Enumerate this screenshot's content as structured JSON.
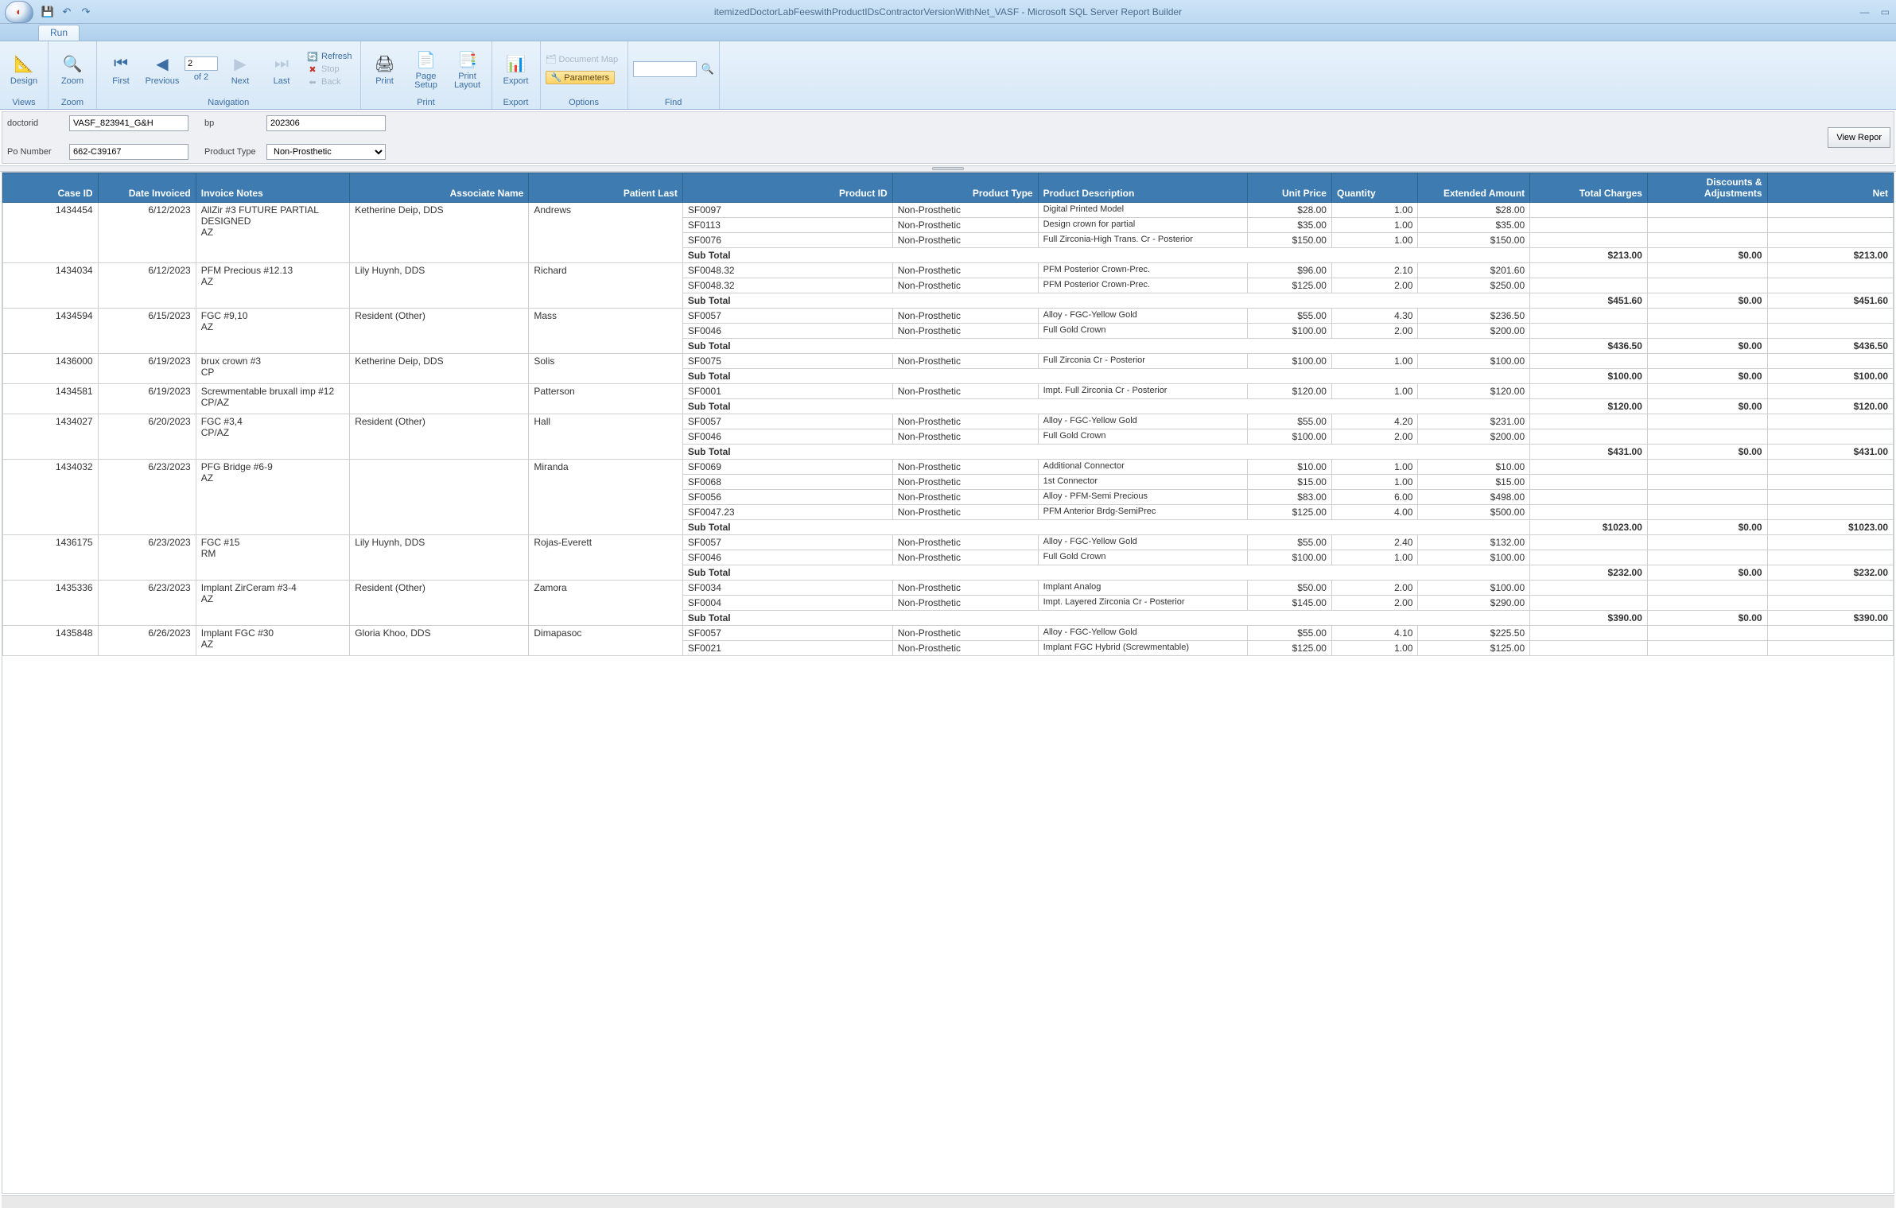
{
  "window": {
    "title": "itemizedDoctorLabFeeswithProductIDsContractorVersionWithNet_VASF - Microsoft SQL Server Report Builder"
  },
  "tabs": {
    "run": "Run"
  },
  "ribbon": {
    "views": {
      "label": "Views",
      "design": "Design"
    },
    "zoom": {
      "label": "Zoom",
      "zoom": "Zoom"
    },
    "navigation": {
      "label": "Navigation",
      "first": "First",
      "previous": "Previous",
      "next": "Next",
      "last": "Last",
      "page": "2",
      "of": "of  2",
      "refresh": "Refresh",
      "stop": "Stop",
      "back": "Back"
    },
    "print": {
      "label": "Print",
      "print": "Print",
      "page_setup": "Page\nSetup",
      "print_layout": "Print\nLayout"
    },
    "export": {
      "label": "Export",
      "export": "Export"
    },
    "options": {
      "label": "Options",
      "document_map": "Document Map",
      "parameters": "Parameters"
    },
    "find": {
      "label": "Find"
    }
  },
  "params": {
    "doctorid_label": "doctorid",
    "doctorid": "VASF_823941_G&H",
    "bp_label": "bp",
    "bp": "202306",
    "po_label": "Po Number",
    "po": "662-C39167",
    "ptype_label": "Product Type",
    "ptype": "Non-Prosthetic",
    "view_report": "View Repor"
  },
  "headers": {
    "case": "Case ID",
    "date": "Date Invoiced",
    "notes": "Invoice Notes",
    "assoc": "Associate Name",
    "patient": "Patient Last",
    "prodid": "Product ID",
    "ptype": "Product Type",
    "pdesc": "Product Description",
    "uprice": "Unit Price",
    "qty": "Quantity",
    "ext": "Extended Amount",
    "total": "Total Charges",
    "disc": "Discounts & Adjustments",
    "net": "Net"
  },
  "subtotal_label": "Sub Total",
  "cases": [
    {
      "case": "1434454",
      "date": "6/12/2023",
      "notes": "AllZir #3    FUTURE PARTIAL DESIGNED\nAZ",
      "assoc": "Ketherine Deip, DDS",
      "patient": "Andrews",
      "lines": [
        {
          "prodid": "SF0097",
          "ptype": "Non-Prosthetic",
          "pdesc": "Digital Printed Model",
          "uprice": "$28.00",
          "qty": "1.00",
          "ext": "$28.00"
        },
        {
          "prodid": "SF0113",
          "ptype": "Non-Prosthetic",
          "pdesc": "Design crown for partial",
          "uprice": "$35.00",
          "qty": "1.00",
          "ext": "$35.00"
        },
        {
          "prodid": "SF0076",
          "ptype": "Non-Prosthetic",
          "pdesc": "Full Zirconia-High Trans. Cr - Posterior",
          "uprice": "$150.00",
          "qty": "1.00",
          "ext": "$150.00"
        }
      ],
      "sub": {
        "total": "$213.00",
        "disc": "$0.00",
        "net": "$213.00"
      }
    },
    {
      "case": "1434034",
      "date": "6/12/2023",
      "notes": "PFM Precious #12.13\nAZ",
      "assoc": "Lily Huynh, DDS",
      "patient": "Richard",
      "lines": [
        {
          "prodid": "SF0048.32",
          "ptype": "Non-Prosthetic",
          "pdesc": "PFM Posterior Crown-Prec.",
          "uprice": "$96.00",
          "qty": "2.10",
          "ext": "$201.60"
        },
        {
          "prodid": "SF0048.32",
          "ptype": "Non-Prosthetic",
          "pdesc": "PFM Posterior Crown-Prec.",
          "uprice": "$125.00",
          "qty": "2.00",
          "ext": "$250.00"
        }
      ],
      "sub": {
        "total": "$451.60",
        "disc": "$0.00",
        "net": "$451.60"
      }
    },
    {
      "case": "1434594",
      "date": "6/15/2023",
      "notes": "FGC #9,10\nAZ",
      "assoc": "Resident  (Other)",
      "patient": "Mass",
      "lines": [
        {
          "prodid": "SF0057",
          "ptype": "Non-Prosthetic",
          "pdesc": "Alloy - FGC-Yellow Gold",
          "uprice": "$55.00",
          "qty": "4.30",
          "ext": "$236.50"
        },
        {
          "prodid": "SF0046",
          "ptype": "Non-Prosthetic",
          "pdesc": "Full Gold Crown",
          "uprice": "$100.00",
          "qty": "2.00",
          "ext": "$200.00"
        }
      ],
      "sub": {
        "total": "$436.50",
        "disc": "$0.00",
        "net": "$436.50"
      }
    },
    {
      "case": "1436000",
      "date": "6/19/2023",
      "notes": "brux crown #3\nCP",
      "assoc": "Ketherine Deip, DDS",
      "patient": "Solis",
      "lines": [
        {
          "prodid": "SF0075",
          "ptype": "Non-Prosthetic",
          "pdesc": "Full Zirconia Cr - Posterior",
          "uprice": "$100.00",
          "qty": "1.00",
          "ext": "$100.00"
        }
      ],
      "sub": {
        "total": "$100.00",
        "disc": "$0.00",
        "net": "$100.00"
      }
    },
    {
      "case": "1434581",
      "date": "6/19/2023",
      "notes": "Screwmentable bruxall imp #12\nCP/AZ",
      "assoc": "",
      "patient": "Patterson",
      "lines": [
        {
          "prodid": "SF0001",
          "ptype": "Non-Prosthetic",
          "pdesc": "Impt. Full Zirconia Cr - Posterior",
          "uprice": "$120.00",
          "qty": "1.00",
          "ext": "$120.00"
        }
      ],
      "sub": {
        "total": "$120.00",
        "disc": "$0.00",
        "net": "$120.00"
      }
    },
    {
      "case": "1434027",
      "date": "6/20/2023",
      "notes": "FGC #3,4\nCP/AZ",
      "assoc": "Resident  (Other)",
      "patient": "Hall",
      "lines": [
        {
          "prodid": "SF0057",
          "ptype": "Non-Prosthetic",
          "pdesc": "Alloy - FGC-Yellow Gold",
          "uprice": "$55.00",
          "qty": "4.20",
          "ext": "$231.00"
        },
        {
          "prodid": "SF0046",
          "ptype": "Non-Prosthetic",
          "pdesc": "Full Gold Crown",
          "uprice": "$100.00",
          "qty": "2.00",
          "ext": "$200.00"
        }
      ],
      "sub": {
        "total": "$431.00",
        "disc": "$0.00",
        "net": "$431.00"
      }
    },
    {
      "case": "1434032",
      "date": "6/23/2023",
      "notes": "PFG Bridge #6-9\nAZ",
      "assoc": "",
      "patient": "Miranda",
      "lines": [
        {
          "prodid": "SF0069",
          "ptype": "Non-Prosthetic",
          "pdesc": "Additional Connector",
          "uprice": "$10.00",
          "qty": "1.00",
          "ext": "$10.00"
        },
        {
          "prodid": "SF0068",
          "ptype": "Non-Prosthetic",
          "pdesc": "1st Connector",
          "uprice": "$15.00",
          "qty": "1.00",
          "ext": "$15.00"
        },
        {
          "prodid": "SF0056",
          "ptype": "Non-Prosthetic",
          "pdesc": "Alloy - PFM-Semi Precious",
          "uprice": "$83.00",
          "qty": "6.00",
          "ext": "$498.00"
        },
        {
          "prodid": "SF0047.23",
          "ptype": "Non-Prosthetic",
          "pdesc": "PFM Anterior Brdg-SemiPrec",
          "uprice": "$125.00",
          "qty": "4.00",
          "ext": "$500.00"
        }
      ],
      "sub": {
        "total": "$1023.00",
        "disc": "$0.00",
        "net": "$1023.00"
      }
    },
    {
      "case": "1436175",
      "date": "6/23/2023",
      "notes": "FGC #15\nRM",
      "assoc": "Lily Huynh, DDS",
      "patient": "Rojas-Everett",
      "lines": [
        {
          "prodid": "SF0057",
          "ptype": "Non-Prosthetic",
          "pdesc": "Alloy - FGC-Yellow Gold",
          "uprice": "$55.00",
          "qty": "2.40",
          "ext": "$132.00"
        },
        {
          "prodid": "SF0046",
          "ptype": "Non-Prosthetic",
          "pdesc": "Full Gold Crown",
          "uprice": "$100.00",
          "qty": "1.00",
          "ext": "$100.00"
        }
      ],
      "sub": {
        "total": "$232.00",
        "disc": "$0.00",
        "net": "$232.00"
      }
    },
    {
      "case": "1435336",
      "date": "6/23/2023",
      "notes": "Implant ZirCeram #3-4\nAZ",
      "assoc": "Resident  (Other)",
      "patient": "Zamora",
      "lines": [
        {
          "prodid": "SF0034",
          "ptype": "Non-Prosthetic",
          "pdesc": "Implant Analog",
          "uprice": "$50.00",
          "qty": "2.00",
          "ext": "$100.00"
        },
        {
          "prodid": "SF0004",
          "ptype": "Non-Prosthetic",
          "pdesc": "Impt. Layered Zirconia Cr - Posterior",
          "uprice": "$145.00",
          "qty": "2.00",
          "ext": "$290.00"
        }
      ],
      "sub": {
        "total": "$390.00",
        "disc": "$0.00",
        "net": "$390.00"
      }
    },
    {
      "case": "1435848",
      "date": "6/26/2023",
      "notes": "Implant FGC #30\nAZ",
      "assoc": "Gloria Khoo, DDS",
      "patient": "Dimapasoc",
      "lines": [
        {
          "prodid": "SF0057",
          "ptype": "Non-Prosthetic",
          "pdesc": "Alloy - FGC-Yellow Gold",
          "uprice": "$55.00",
          "qty": "4.10",
          "ext": "$225.50"
        },
        {
          "prodid": "SF0021",
          "ptype": "Non-Prosthetic",
          "pdesc": "Implant FGC Hybrid (Screwmentable)",
          "uprice": "$125.00",
          "qty": "1.00",
          "ext": "$125.00"
        }
      ],
      "sub": null
    }
  ]
}
